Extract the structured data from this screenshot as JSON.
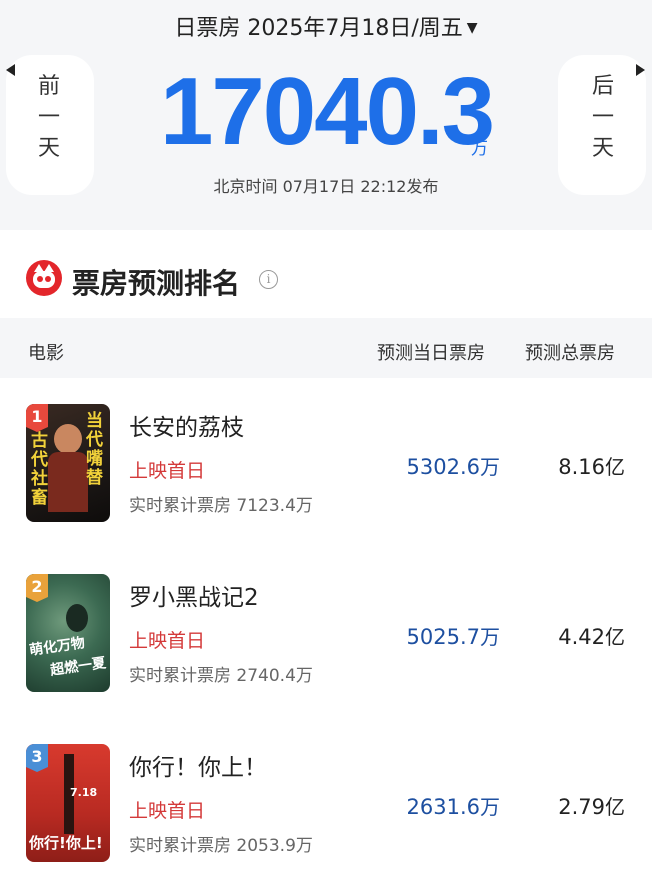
{
  "header": {
    "date_line": "日票房 2025年7月18日/周五",
    "prev_label": [
      "前",
      "一",
      "天"
    ],
    "next_label": [
      "后",
      "一",
      "天"
    ],
    "box_office": "17040.3",
    "unit": "万",
    "release_line": "北京时间  07月17日  22:12发布"
  },
  "section": {
    "title": "票房预测排名"
  },
  "columns": {
    "movie": "电影",
    "today": "预测当日票房",
    "total": "预测总票房"
  },
  "movies": [
    {
      "rank": "1",
      "title": "长安的荔枝",
      "badge": "上映首日",
      "cumulative": "实时累计票房 7123.4万",
      "today_value": "5302.6",
      "today_unit": "万",
      "total_value": "8.16",
      "total_unit": "亿",
      "poster_text_a": "当代嘴替",
      "poster_text_b": "古代社畜"
    },
    {
      "rank": "2",
      "title": "罗小黑战记2",
      "badge": "上映首日",
      "cumulative": "实时累计票房 2740.4万",
      "today_value": "5025.7",
      "today_unit": "万",
      "total_value": "4.42",
      "total_unit": "亿",
      "poster_text_a": "萌化万物",
      "poster_text_b": "超燃一夏"
    },
    {
      "rank": "3",
      "title": "你行！你上！",
      "badge": "上映首日",
      "cumulative": "实时累计票房 2053.9万",
      "today_value": "2631.6",
      "today_unit": "万",
      "total_value": "2.79",
      "total_unit": "亿",
      "poster_text_a": "7.18",
      "poster_text_b": "你行!你上!"
    }
  ],
  "colors": {
    "accent_blue": "#1e6fe8",
    "badge_red": "#d43a3a",
    "today_blue": "#1d4fa0"
  }
}
